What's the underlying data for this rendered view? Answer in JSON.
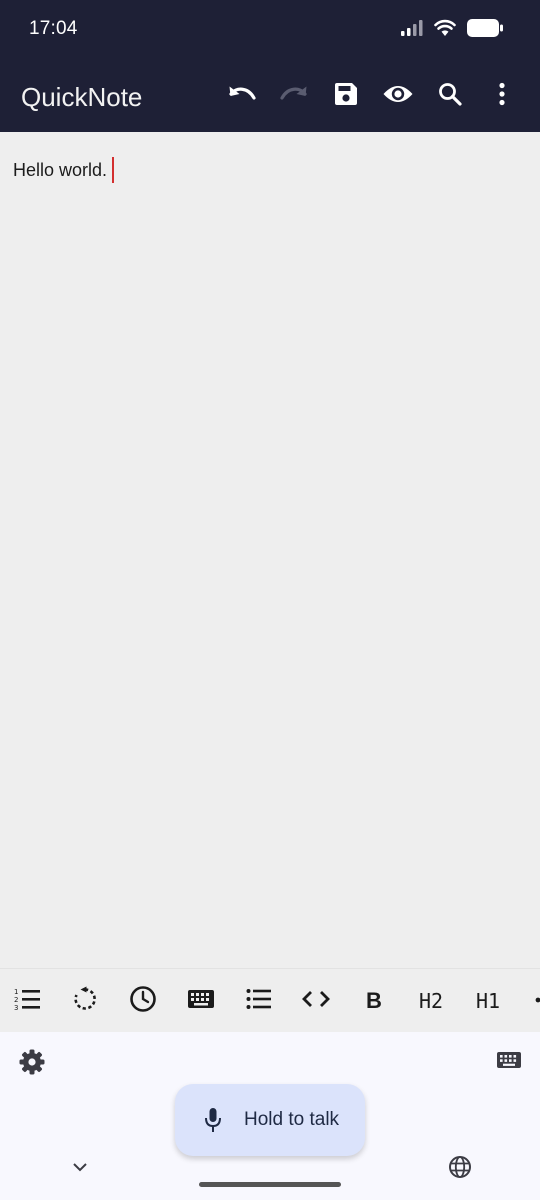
{
  "status_bar": {
    "time": "17:04",
    "icons": [
      "signal-icon",
      "wifi-icon",
      "battery-icon"
    ]
  },
  "app_bar": {
    "title": "QuickNote",
    "actions": [
      "undo-icon",
      "redo-icon",
      "save-icon",
      "preview-eye-icon",
      "search-icon",
      "more-vert-icon"
    ],
    "redo_enabled": false
  },
  "editor": {
    "text": "Hello world.",
    "cursor_color": "#d32f2f"
  },
  "toolbar": {
    "buttons": [
      {
        "name": "numbered-list-icon",
        "label": ""
      },
      {
        "name": "rotate-icon",
        "label": ""
      },
      {
        "name": "clock-icon",
        "label": ""
      },
      {
        "name": "keyboard-icon",
        "label": ""
      },
      {
        "name": "bullet-list-icon",
        "label": ""
      },
      {
        "name": "code-icon",
        "label": ""
      },
      {
        "name": "bold-button",
        "label": "B"
      },
      {
        "name": "heading2-button",
        "label": "H2"
      },
      {
        "name": "heading1-button",
        "label": "H1"
      }
    ]
  },
  "voice_panel": {
    "hold_to_talk_label": "Hold to talk",
    "icons": [
      "settings-gear-icon",
      "keyboard-switch-icon",
      "chevron-down-icon",
      "globe-icon",
      "microphone-icon"
    ]
  },
  "colors": {
    "app_bar_bg": "#1e2036",
    "editor_bg": "#eeeeee",
    "panel_bg": "#f8f8fe",
    "hold_button_bg": "#dbe3fb"
  }
}
